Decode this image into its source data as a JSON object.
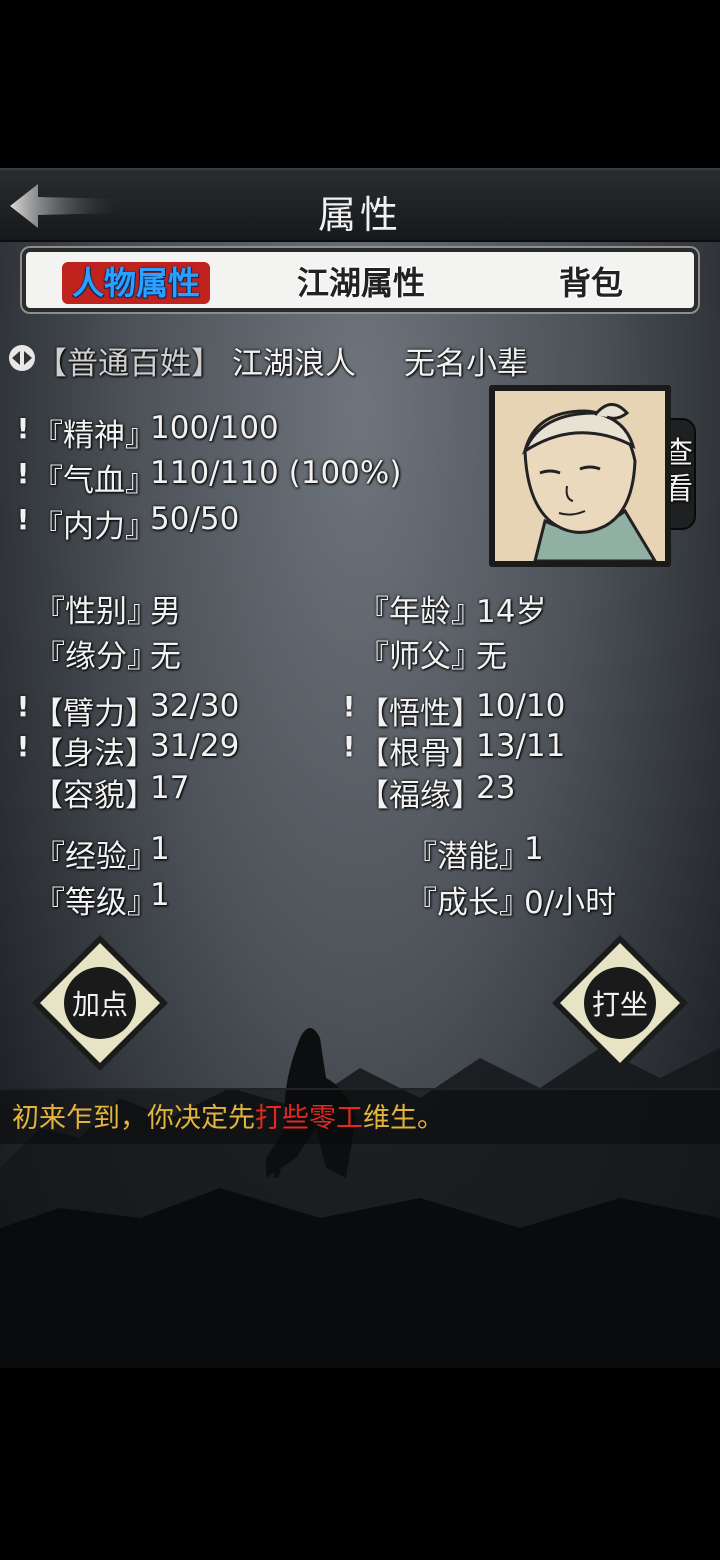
{
  "header": {
    "title": "属性",
    "back_icon": "back-arrow-icon"
  },
  "tabs": [
    {
      "label": "人物属性",
      "active": true
    },
    {
      "label": "江湖属性",
      "active": false
    },
    {
      "label": "背包",
      "active": false
    }
  ],
  "identity": {
    "class": "【普通百姓】",
    "title1": "江湖浪人",
    "title2": "无名小辈"
  },
  "vitals": [
    {
      "label": "『精神』",
      "value": "100/100"
    },
    {
      "label": "『气血』",
      "value": "110/110 (100%)"
    },
    {
      "label": "『内力』",
      "value": "50/50"
    }
  ],
  "portrait": {
    "view_label": "查看"
  },
  "info": {
    "gender_label": "『性别』",
    "gender_value": "男",
    "age_label": "『年龄』",
    "age_value": "14岁",
    "fate_label": "『缘分』",
    "fate_value": "无",
    "master_label": "『师父』",
    "master_value": "无"
  },
  "attributes": {
    "strength_label": "【臂力】",
    "strength_value": "32/30",
    "insight_label": "【悟性】",
    "insight_value": "10/10",
    "agility_label": "【身法】",
    "agility_value": "31/29",
    "constitution_label": "【根骨】",
    "constitution_value": "13/11",
    "looks_label": "【容貌】",
    "looks_value": "17",
    "luck_label": "【福缘】",
    "luck_value": "23"
  },
  "progress": {
    "exp_label": "『经验』",
    "exp_value": "1",
    "potential_label": "『潜能』",
    "potential_value": "1",
    "level_label": "『等级』",
    "level_value": "1",
    "growth_label": "『成长』",
    "growth_value": "0/小时"
  },
  "buttons": {
    "add_points": "加点",
    "meditate": "打坐"
  },
  "message": {
    "part1": "初来乍到，你决定先",
    "highlight": "打些零工",
    "part2": "维生。"
  },
  "colors": {
    "tab_active_bg": "#c0221d",
    "tab_active_text": "#2aa0ff",
    "message_text": "#e3b33c",
    "message_highlight": "#e2281f"
  }
}
